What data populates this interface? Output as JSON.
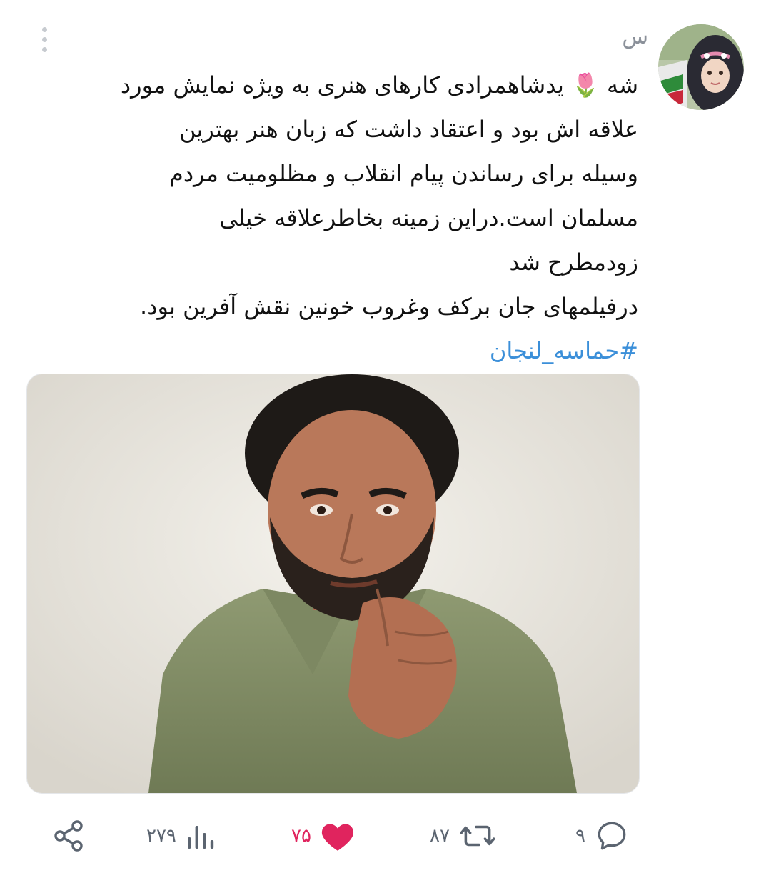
{
  "tweet": {
    "author_display": "س",
    "text_lines": [
      "شه 🌷 یدشاهمرادی کارهای هنری به ویژه نمایش مورد",
      "علاقه اش بود و اعتقاد داشت که زبان هنر بهترین",
      "وسیله برای رساندن پیام انقلاب و مظلومیت مردم",
      "مسلمان است.دراین زمینه بخاطرعلاقه خیلی",
      "زودمطرح شد",
      "درفیلمهای جان برکف وغروب خونین نقش آفرین بود."
    ],
    "hashtag": "#حماسه_لنجان"
  },
  "actions": {
    "replies": "۹",
    "retweets": "۸۷",
    "likes": "۷۵",
    "views": "۲۷۹"
  },
  "colors": {
    "like": "#e0245e",
    "hashtag": "#3b8fd9",
    "muted": "#5b6470"
  },
  "icons": [
    "more-vertical-icon",
    "reply-icon",
    "retweet-icon",
    "heart-icon",
    "views-icon",
    "share-icon"
  ]
}
